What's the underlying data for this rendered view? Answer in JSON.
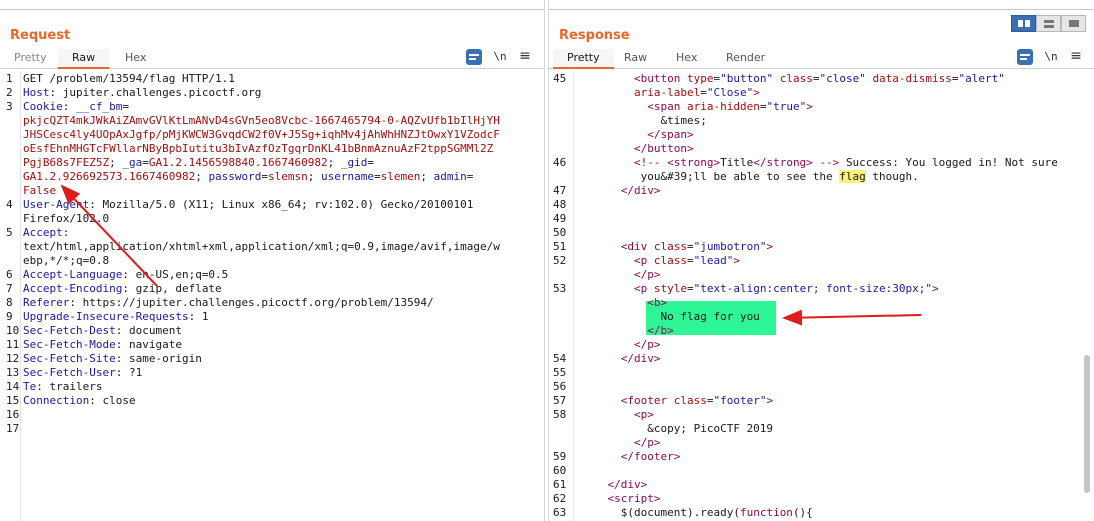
{
  "request": {
    "title": "Request",
    "tabs": [
      "Pretty",
      "Raw",
      "Hex"
    ],
    "newline_label": "\\n",
    "lines": [
      {
        "n": "1",
        "parts": [
          {
            "t": "GET /problem/13594/flag HTTP/1.1",
            "c": ""
          }
        ]
      },
      {
        "n": "2",
        "parts": [
          {
            "t": "Host",
            "c": "hk"
          },
          {
            "t": ": jupiter.challenges.picoctf.org",
            "c": ""
          }
        ]
      },
      {
        "n": "3",
        "parts": [
          {
            "t": "Cookie",
            "c": "hk"
          },
          {
            "t": ": ",
            "c": ""
          },
          {
            "t": "__cf_bm",
            "c": "hk"
          },
          {
            "t": "=",
            "c": ""
          }
        ]
      },
      {
        "n": "",
        "parts": [
          {
            "t": "pkjcQZT4mkJWkAiZAmvGVlKtLmANvD4sGVn5eo8Vcbc-1667465794-0-AQZvUfb1bIlHjYH",
            "c": "red"
          }
        ]
      },
      {
        "n": "",
        "parts": [
          {
            "t": "JHSCesc4ly4UOpAxJgfp/pMjKWCW3GvqdCW2f0V+J5Sg+iqhMv4jAhWhHNZJtOwxY1VZodcF",
            "c": "red"
          }
        ]
      },
      {
        "n": "",
        "parts": [
          {
            "t": "oEsfEhnMHGTcFWllarNByBpbIutitu3bIvAzfOzTgqrDnKL41bBnmAznuAzF2tppSGMMl2Z",
            "c": "red"
          }
        ]
      },
      {
        "n": "",
        "parts": [
          {
            "t": "PgjB68s7FEZ5Z",
            "c": "red"
          },
          {
            "t": "; ",
            "c": ""
          },
          {
            "t": "_ga",
            "c": "hk"
          },
          {
            "t": "=",
            "c": ""
          },
          {
            "t": "GA1.2.1456598840.1667460982",
            "c": "red"
          },
          {
            "t": "; ",
            "c": ""
          },
          {
            "t": "_gid",
            "c": "hk"
          },
          {
            "t": "=",
            "c": ""
          }
        ]
      },
      {
        "n": "",
        "parts": [
          {
            "t": "GA1.2.926692573.1667460982",
            "c": "red"
          },
          {
            "t": "; ",
            "c": ""
          },
          {
            "t": "password",
            "c": "hk"
          },
          {
            "t": "=",
            "c": ""
          },
          {
            "t": "slemsn",
            "c": "red"
          },
          {
            "t": "; ",
            "c": ""
          },
          {
            "t": "username",
            "c": "hk"
          },
          {
            "t": "=",
            "c": ""
          },
          {
            "t": "slemen",
            "c": "red"
          },
          {
            "t": "; ",
            "c": ""
          },
          {
            "t": "admin",
            "c": "hk"
          },
          {
            "t": "=",
            "c": ""
          }
        ]
      },
      {
        "n": "",
        "parts": [
          {
            "t": "False",
            "c": "red"
          }
        ],
        "hl": true
      },
      {
        "n": "4",
        "parts": [
          {
            "t": "User-Agent",
            "c": "hk"
          },
          {
            "t": ": Mozilla/5.0 (X11; Linux x86_64; rv:102.0) Gecko/20100101",
            "c": ""
          }
        ]
      },
      {
        "n": "",
        "parts": [
          {
            "t": "Firefox/102.0",
            "c": ""
          }
        ]
      },
      {
        "n": "5",
        "parts": [
          {
            "t": "Accept",
            "c": "hk"
          },
          {
            "t": ":",
            "c": ""
          }
        ]
      },
      {
        "n": "",
        "parts": [
          {
            "t": "text/html,application/xhtml+xml,application/xml;q=0.9,image/avif,image/w",
            "c": ""
          }
        ]
      },
      {
        "n": "",
        "parts": [
          {
            "t": "ebp,*/*;q=0.8",
            "c": ""
          }
        ]
      },
      {
        "n": "6",
        "parts": [
          {
            "t": "Accept-Language",
            "c": "hk"
          },
          {
            "t": ": en-US,en;q=0.5",
            "c": ""
          }
        ]
      },
      {
        "n": "7",
        "parts": [
          {
            "t": "Accept-Encoding",
            "c": "hk"
          },
          {
            "t": ": gzip, deflate",
            "c": ""
          }
        ]
      },
      {
        "n": "8",
        "parts": [
          {
            "t": "Referer",
            "c": "hk"
          },
          {
            "t": ": https://jupiter.challenges.picoctf.org/problem/13594/",
            "c": ""
          }
        ]
      },
      {
        "n": "9",
        "parts": [
          {
            "t": "Upgrade-Insecure-Requests",
            "c": "hk"
          },
          {
            "t": ": 1",
            "c": ""
          }
        ]
      },
      {
        "n": "10",
        "parts": [
          {
            "t": "Sec-Fetch-Dest",
            "c": "hk"
          },
          {
            "t": ": document",
            "c": ""
          }
        ]
      },
      {
        "n": "11",
        "parts": [
          {
            "t": "Sec-Fetch-Mode",
            "c": "hk"
          },
          {
            "t": ": navigate",
            "c": ""
          }
        ]
      },
      {
        "n": "12",
        "parts": [
          {
            "t": "Sec-Fetch-Site",
            "c": "hk"
          },
          {
            "t": ": same-origin",
            "c": ""
          }
        ]
      },
      {
        "n": "13",
        "parts": [
          {
            "t": "Sec-Fetch-User",
            "c": "hk"
          },
          {
            "t": ": ?1",
            "c": ""
          }
        ]
      },
      {
        "n": "14",
        "parts": [
          {
            "t": "Te",
            "c": "hk"
          },
          {
            "t": ": trailers",
            "c": ""
          }
        ]
      },
      {
        "n": "15",
        "parts": [
          {
            "t": "Connection",
            "c": "hk"
          },
          {
            "t": ": close",
            "c": ""
          }
        ]
      },
      {
        "n": "16",
        "parts": []
      },
      {
        "n": "17",
        "parts": []
      }
    ]
  },
  "response": {
    "title": "Response",
    "tabs": [
      "Pretty",
      "Raw",
      "Hex",
      "Render"
    ],
    "newline_label": "\\n",
    "menu_glyph": "≡",
    "lines": [
      {
        "n": "45",
        "parts": [
          {
            "t": "        <button ",
            "c": "tag"
          },
          {
            "t": "type",
            "c": "attr"
          },
          {
            "t": "=",
            "c": ""
          },
          {
            "t": "\"button\"",
            "c": "val"
          },
          {
            "t": " ",
            "c": ""
          },
          {
            "t": "class",
            "c": "attr"
          },
          {
            "t": "=",
            "c": ""
          },
          {
            "t": "\"close\"",
            "c": "val"
          },
          {
            "t": " ",
            "c": ""
          },
          {
            "t": "data-dismiss",
            "c": "attr"
          },
          {
            "t": "=",
            "c": ""
          },
          {
            "t": "\"alert\"",
            "c": "val"
          }
        ]
      },
      {
        "n": "",
        "parts": [
          {
            "t": "        aria-label",
            "c": "attr"
          },
          {
            "t": "=",
            "c": ""
          },
          {
            "t": "\"Close\"",
            "c": "val"
          },
          {
            "t": ">",
            "c": "tag"
          }
        ]
      },
      {
        "n": "",
        "parts": [
          {
            "t": "          <span ",
            "c": "tag"
          },
          {
            "t": "aria-hidden",
            "c": "attr"
          },
          {
            "t": "=",
            "c": ""
          },
          {
            "t": "\"true\"",
            "c": "val"
          },
          {
            "t": ">",
            "c": "tag"
          }
        ]
      },
      {
        "n": "",
        "parts": [
          {
            "t": "            &times;",
            "c": ""
          }
        ]
      },
      {
        "n": "",
        "parts": [
          {
            "t": "          </span>",
            "c": "tag"
          }
        ]
      },
      {
        "n": "",
        "parts": [
          {
            "t": "        </button>",
            "c": "tag"
          }
        ]
      },
      {
        "n": "46",
        "parts": [
          {
            "t": "        <!-- ",
            "c": "tag"
          },
          {
            "t": "<strong>",
            "c": "tag"
          },
          {
            "t": "Title",
            "c": ""
          },
          {
            "t": "</strong>",
            "c": "tag"
          },
          {
            "t": " --> ",
            "c": "tag"
          },
          {
            "t": "Success: You logged in! Not sure",
            "c": ""
          }
        ]
      },
      {
        "n": "",
        "parts": [
          {
            "t": "         you&#39;ll be able to see the ",
            "c": ""
          },
          {
            "t": "flag",
            "c": "flagword"
          },
          {
            "t": " though.",
            "c": ""
          }
        ]
      },
      {
        "n": "47",
        "parts": [
          {
            "t": "      </div>",
            "c": "tag"
          }
        ]
      },
      {
        "n": "48",
        "parts": []
      },
      {
        "n": "49",
        "parts": []
      },
      {
        "n": "50",
        "parts": []
      },
      {
        "n": "51",
        "parts": [
          {
            "t": "      <div ",
            "c": "tag"
          },
          {
            "t": "class",
            "c": "attr"
          },
          {
            "t": "=",
            "c": ""
          },
          {
            "t": "\"jumbotron\"",
            "c": "val"
          },
          {
            "t": ">",
            "c": "tag"
          }
        ]
      },
      {
        "n": "52",
        "parts": [
          {
            "t": "        <p ",
            "c": "tag"
          },
          {
            "t": "class",
            "c": "attr"
          },
          {
            "t": "=",
            "c": ""
          },
          {
            "t": "\"lead\"",
            "c": "val"
          },
          {
            "t": ">",
            "c": "tag"
          }
        ]
      },
      {
        "n": "",
        "parts": [
          {
            "t": "        </p>",
            "c": "tag"
          }
        ]
      },
      {
        "n": "53",
        "parts": [
          {
            "t": "        <p ",
            "c": "tag"
          },
          {
            "t": "style",
            "c": "attr"
          },
          {
            "t": "=",
            "c": ""
          },
          {
            "t": "\"text-align:center; font-size:30px;\"",
            "c": "val"
          },
          {
            "t": ">",
            "c": "tag"
          }
        ]
      },
      {
        "n": "",
        "parts": [
          {
            "t": "          <b>",
            "c": "tag"
          }
        ]
      },
      {
        "n": "",
        "parts": [
          {
            "t": "            No flag for you",
            "c": ""
          }
        ]
      },
      {
        "n": "",
        "parts": [
          {
            "t": "          </b>",
            "c": "tag"
          }
        ]
      },
      {
        "n": "",
        "parts": [
          {
            "t": "        </p>",
            "c": "tag"
          }
        ]
      },
      {
        "n": "54",
        "parts": [
          {
            "t": "      </div>",
            "c": "tag"
          }
        ]
      },
      {
        "n": "55",
        "parts": []
      },
      {
        "n": "56",
        "parts": []
      },
      {
        "n": "57",
        "parts": [
          {
            "t": "      <footer ",
            "c": "tag"
          },
          {
            "t": "class",
            "c": "attr"
          },
          {
            "t": "=",
            "c": ""
          },
          {
            "t": "\"footer\"",
            "c": "val"
          },
          {
            "t": ">",
            "c": "tag"
          }
        ]
      },
      {
        "n": "58",
        "parts": [
          {
            "t": "        <p>",
            "c": "tag"
          }
        ]
      },
      {
        "n": "",
        "parts": [
          {
            "t": "          &copy; PicoCTF 2019",
            "c": ""
          }
        ]
      },
      {
        "n": "",
        "parts": [
          {
            "t": "        </p>",
            "c": "tag"
          }
        ]
      },
      {
        "n": "59",
        "parts": [
          {
            "t": "      </footer>",
            "c": "tag"
          }
        ]
      },
      {
        "n": "60",
        "parts": []
      },
      {
        "n": "61",
        "parts": [
          {
            "t": "    </div>",
            "c": "tag"
          }
        ]
      },
      {
        "n": "62",
        "parts": [
          {
            "t": "    <script>",
            "c": "tag"
          }
        ]
      },
      {
        "n": "63",
        "parts": [
          {
            "t": "      $(document).ready(",
            "c": ""
          },
          {
            "t": "function",
            "c": "tag"
          },
          {
            "t": "(){",
            "c": ""
          }
        ]
      }
    ]
  },
  "colors": {
    "accent": "#e8692b",
    "header_key": "#1a1a9e",
    "cookie_value": "#a01010",
    "highlight_box": "#2ef595",
    "annotation_arrow": "#e01b1b"
  }
}
